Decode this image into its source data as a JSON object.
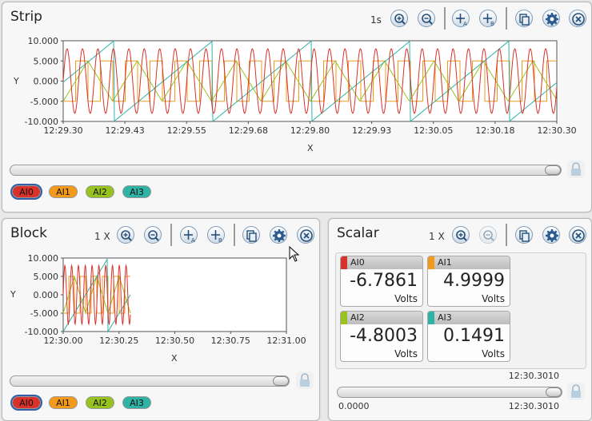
{
  "colors": {
    "AI0": "#d9322b",
    "AI1": "#f39a1a",
    "AI2": "#98c21f",
    "AI3": "#2fb3a6"
  },
  "strip": {
    "title": "Strip",
    "zoom": "1s",
    "y_label": "Y",
    "x_label": "X",
    "y_ticks": [
      "10.000",
      "5.000",
      "0.000",
      "-5.000",
      "-10.000"
    ],
    "x_ticks": [
      "12:29.30",
      "12:29.43",
      "12:29.55",
      "12:29.68",
      "12:29.80",
      "12:29.93",
      "12:30.05",
      "12:30.18",
      "12:30.30"
    ],
    "channels": [
      "AI0",
      "AI1",
      "AI2",
      "AI3"
    ],
    "selected": "AI0"
  },
  "block": {
    "title": "Block",
    "zoom": "1 X",
    "y_label": "Y",
    "x_label": "X",
    "y_ticks": [
      "10.000",
      "5.000",
      "0.000",
      "-5.000",
      "-10.000"
    ],
    "x_ticks": [
      "12:30.00",
      "12:30.25",
      "12:30.50",
      "12:30.75",
      "12:31.00"
    ],
    "channels": [
      "AI0",
      "AI1",
      "AI2",
      "AI3"
    ],
    "selected": "AI0"
  },
  "scalar": {
    "title": "Scalar",
    "zoom": "1 X",
    "cards": [
      {
        "name": "AI0",
        "value": "-6.7861",
        "unit": "Volts"
      },
      {
        "name": "AI1",
        "value": "4.9999",
        "unit": "Volts"
      },
      {
        "name": "AI2",
        "value": "-4.8003",
        "unit": "Volts"
      },
      {
        "name": "AI3",
        "value": "0.1491",
        "unit": "Volts"
      }
    ],
    "timestamp": "12:30.3010",
    "slider_start": "0.0000",
    "slider_end": "12:30.3010"
  }
}
